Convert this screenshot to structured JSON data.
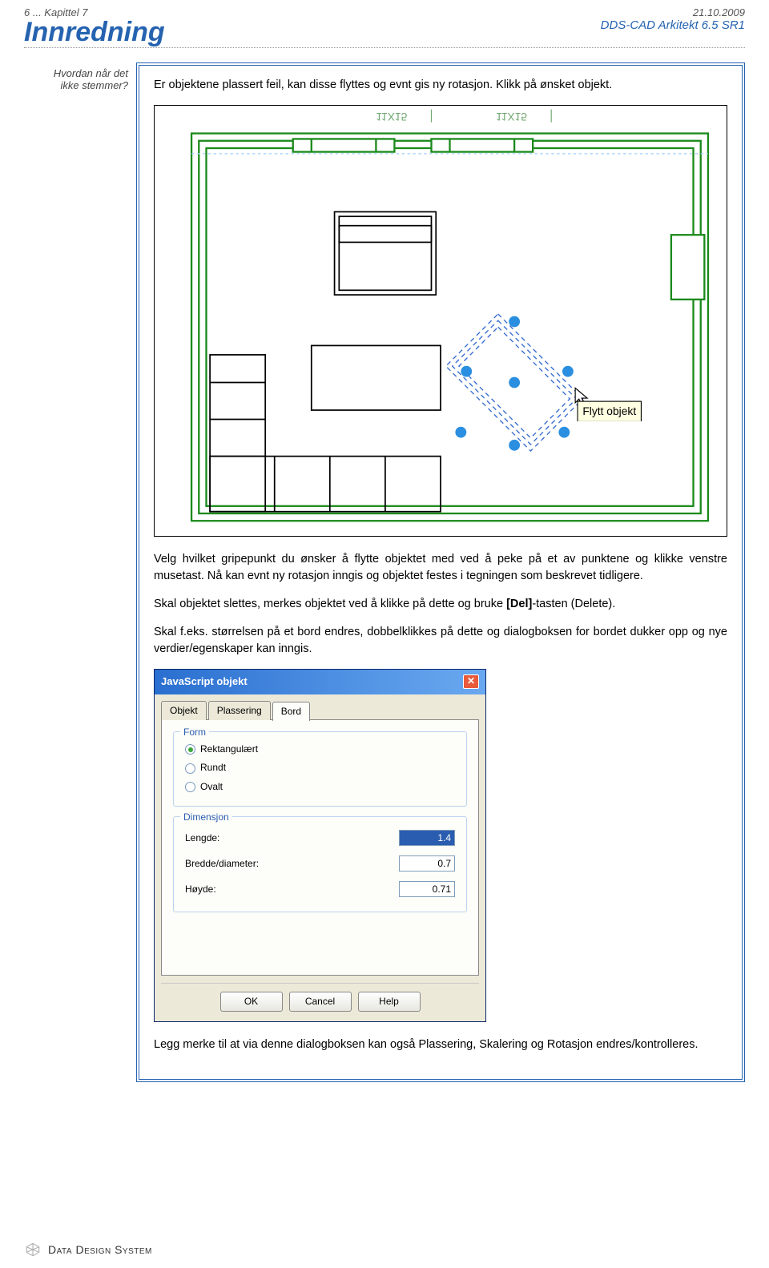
{
  "header": {
    "page_ref": "6 ... Kapittel 7",
    "date": "21.10.2009",
    "title": "Innredning",
    "product": "DDS-CAD Arkitekt 6.5 SR1"
  },
  "sidebar": {
    "note_line1": "Hvordan når det",
    "note_line2": "ikke stemmer?"
  },
  "content": {
    "para1": "Er objektene plassert feil, kan disse flyttes og evnt gis ny rotasjon. Klikk på ønsket objekt.",
    "cad_tooltip": "Flytt objekt",
    "cad_label1": "11X15",
    "cad_label2": "11X15",
    "para2": "Velg hvilket gripepunkt du ønsker å flytte objektet med ved å peke på et av punktene og klikke venstre musetast. Nå kan evnt ny rotasjon inngis og objektet festes i tegningen som beskrevet tidligere.",
    "para3a": "Skal objektet slettes, merkes objektet ved å klikke på dette og bruke ",
    "para3b_bold": "[Del]",
    "para3c": "-tasten (Delete).",
    "para4": "Skal f.eks. størrelsen på et bord endres, dobbelklikkes på dette og dialogboksen for bordet dukker opp og nye verdier/egenskaper kan inngis.",
    "para5": "Legg merke til at via denne dialogboksen kan også Plassering, Skalering og Rotasjon endres/kontrolleres."
  },
  "dialog": {
    "title": "JavaScript objekt",
    "tabs": [
      "Objekt",
      "Plassering",
      "Bord"
    ],
    "active_tab": 2,
    "form": {
      "legend": "Form",
      "options": [
        {
          "label": "Rektangulært",
          "checked": true
        },
        {
          "label": "Rundt",
          "checked": false
        },
        {
          "label": "Ovalt",
          "checked": false
        }
      ]
    },
    "dimensjon": {
      "legend": "Dimensjon",
      "rows": [
        {
          "label": "Lengde:",
          "value": "1.4",
          "selected": true
        },
        {
          "label": "Bredde/diameter:",
          "value": "0.7",
          "selected": false
        },
        {
          "label": "Høyde:",
          "value": "0.71",
          "selected": false
        }
      ]
    },
    "buttons": {
      "ok": "OK",
      "cancel": "Cancel",
      "help": "Help"
    }
  },
  "footer": {
    "company": "Data Design System"
  }
}
